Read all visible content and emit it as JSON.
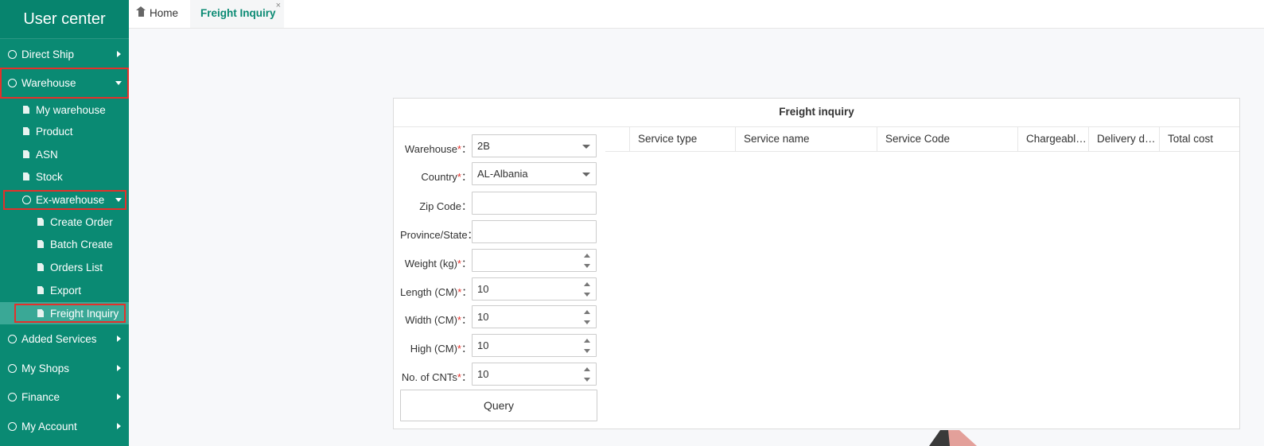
{
  "sidebar": {
    "title": "User center",
    "items": [
      {
        "label": "Direct Ship"
      },
      {
        "label": "Warehouse"
      },
      {
        "label": "My warehouse"
      },
      {
        "label": "Product"
      },
      {
        "label": "ASN"
      },
      {
        "label": "Stock"
      },
      {
        "label": "Ex-warehouse"
      },
      {
        "label": "Create Order"
      },
      {
        "label": "Batch Create"
      },
      {
        "label": "Orders List"
      },
      {
        "label": "Export"
      },
      {
        "label": "Freight Inquiry"
      },
      {
        "label": "Added Services"
      },
      {
        "label": "My Shops"
      },
      {
        "label": "Finance"
      },
      {
        "label": "My Account"
      }
    ]
  },
  "tabs": {
    "home": "Home",
    "active": "Freight Inquiry",
    "close": "×"
  },
  "panel": {
    "title": "Freight inquiry",
    "form": {
      "warehouse": {
        "label": "Warehouse",
        "value": "2B"
      },
      "country": {
        "label": "Country",
        "value": "AL-Albania"
      },
      "zip": {
        "label": "Zip Code",
        "value": ""
      },
      "province": {
        "label": "Province/State",
        "value": ""
      },
      "weight": {
        "label": "Weight (kg)",
        "value": ""
      },
      "length": {
        "label": "Length (CM)",
        "value": "10"
      },
      "width": {
        "label": "Width (CM)",
        "value": "10"
      },
      "high": {
        "label": "High (CM)",
        "value": "10"
      },
      "cnts": {
        "label": "No. of CNTs",
        "value": "10"
      },
      "required_mark": "*",
      "colon": "："
    },
    "query_label": "Query",
    "columns": [
      "Service type",
      "Service name",
      "Service Code",
      "Chargeable weight",
      "Delivery days",
      "Total cost"
    ]
  }
}
